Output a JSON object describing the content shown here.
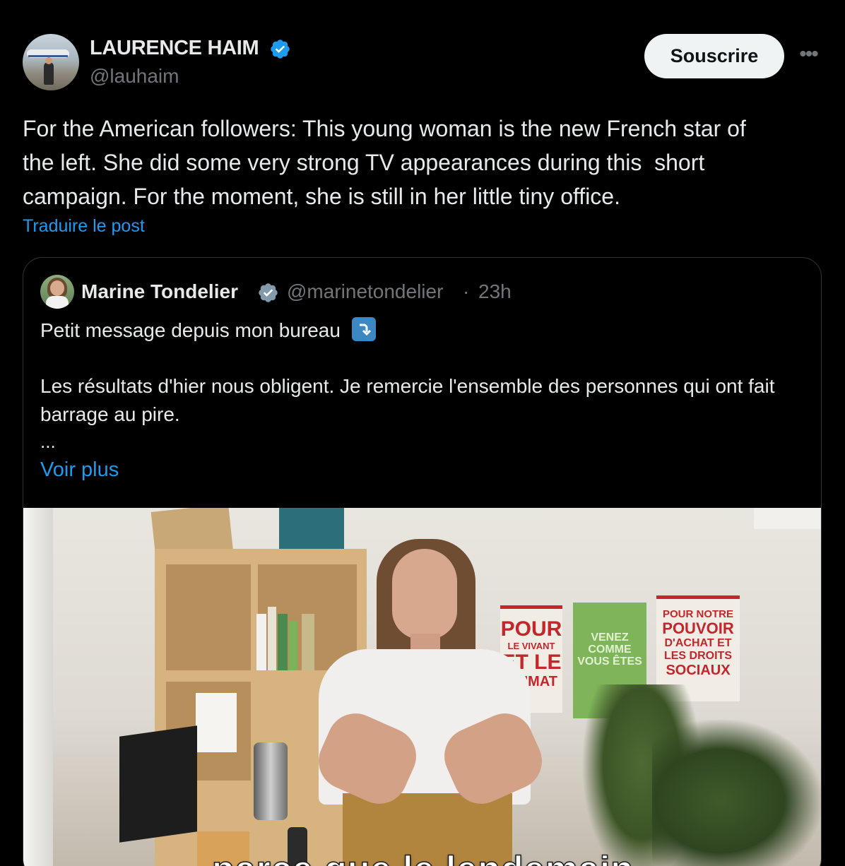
{
  "post": {
    "author_name": "LAURENCE HAIM",
    "handle": "@lauhaim",
    "subscribe_label": "Souscrire",
    "more_icon": "more-horizontal-icon",
    "text": "For the American followers: This young woman is the new French star of\nthe left. She did some very strong TV appearances during this  short\ncampaign. For the moment, she is still in her little tiny office.",
    "translate_label": "Traduire le post"
  },
  "quote": {
    "name": "Marine Tondelier",
    "handle": "@marinetondelier",
    "separator": "·",
    "time": "23h",
    "line1": "Petit message depuis mon bureau",
    "line1_emoji": "right-arrow-curving-down-icon",
    "paragraph": "Les résultats d'hier nous obligent. Je remercie l'ensemble des personnes qui ont fait barrage au pire.",
    "ellipsis": "...",
    "see_more_label": "Voir plus",
    "video": {
      "caption": "parce que le lendemain",
      "poster1_lines": [
        "POUR",
        "LE VIVANT",
        "ET LE",
        "CLIMAT"
      ],
      "poster2_lines": [
        "VENEZ",
        "COMME",
        "VOUS ÊTES"
      ],
      "poster3_lines": [
        "POUR NOTRE",
        "POUVOIR",
        "D'ACHAT ET",
        "LES DROITS",
        "SOCIAUX"
      ]
    }
  },
  "colors": {
    "background": "#000000",
    "text": "#e7e9ea",
    "secondary": "#71767b",
    "link": "#1d9bf0",
    "border": "#2f3336",
    "verified": "#1d9bf0",
    "verified_gray": "#829aab"
  }
}
